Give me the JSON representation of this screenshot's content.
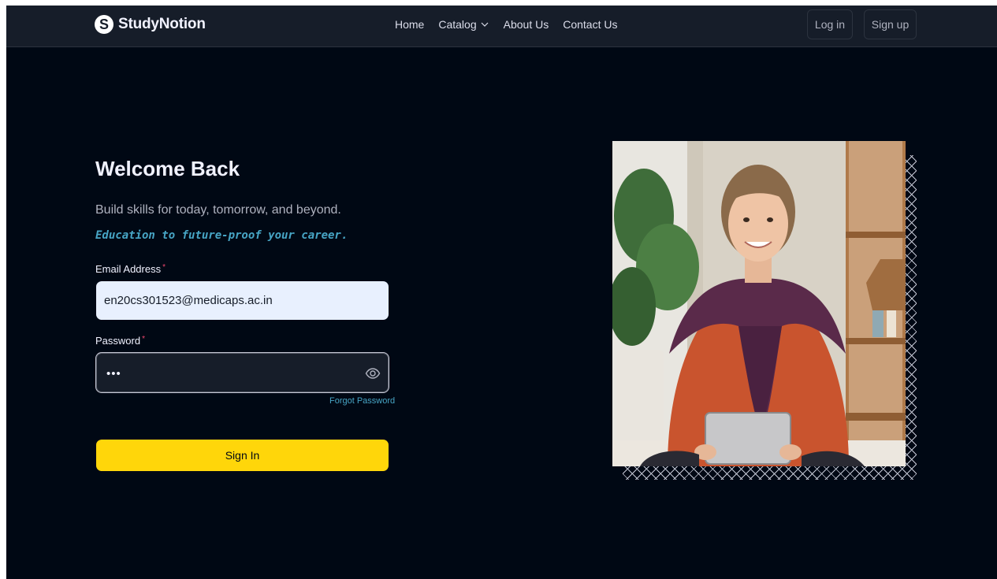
{
  "brand": {
    "logo_letter": "S",
    "name": "StudyNotion"
  },
  "nav": {
    "home": "Home",
    "catalog": "Catalog",
    "about": "About Us",
    "contact": "Contact Us",
    "login": "Log in",
    "signup": "Sign up"
  },
  "login": {
    "title": "Welcome Back",
    "subtitle": "Build skills for today, tomorrow, and beyond.",
    "subtitle_accent": "Education to future-proof your career.",
    "email_label": "Email Address",
    "required_mark": "*",
    "email_value": "en20cs301523@medicaps.ac.in",
    "password_label": "Password",
    "password_value": "abc",
    "forgot": "Forgot Password",
    "submit": "Sign In"
  },
  "colors": {
    "background": "#000814",
    "navbar": "#161d29",
    "accent_yellow": "#ffd60a",
    "accent_blue": "#47a5c5",
    "required_pink": "#ef476f"
  },
  "icons": {
    "catalog": "chevron-down-icon",
    "password_toggle": "eye-icon"
  }
}
